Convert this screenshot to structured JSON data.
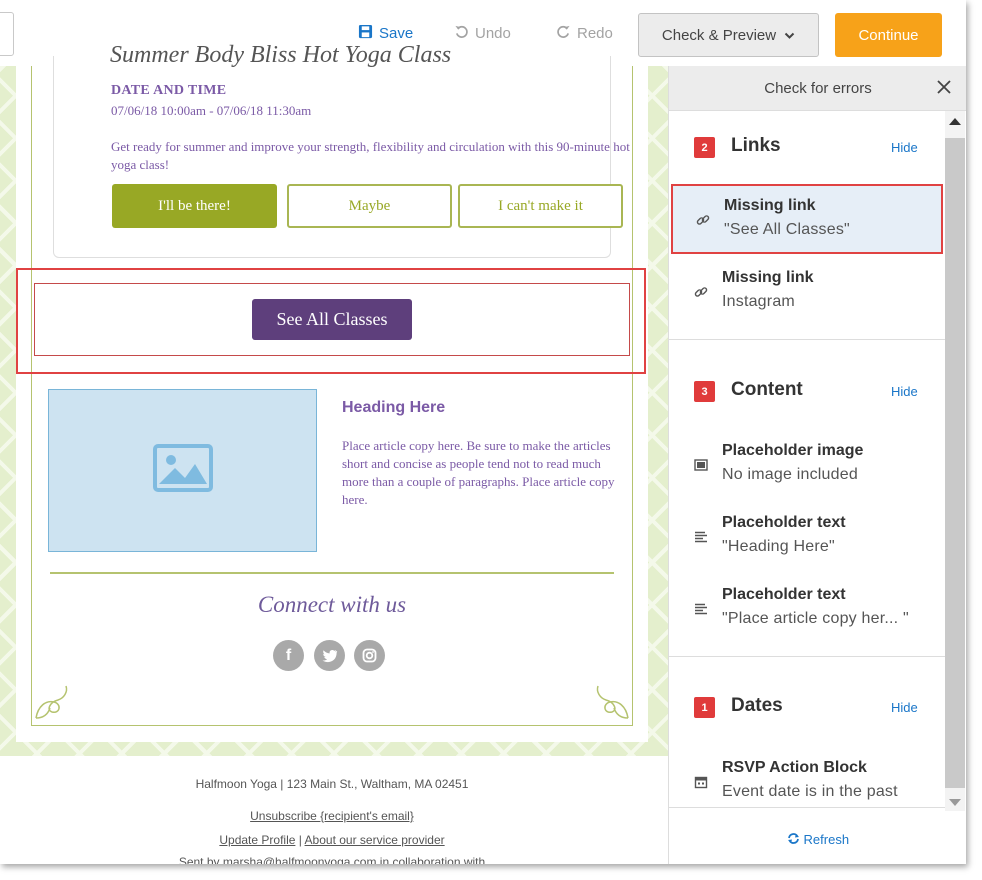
{
  "toolbar": {
    "save_label": "Save",
    "undo_label": "Undo",
    "redo_label": "Redo",
    "preview_label": "Check & Preview",
    "continue_label": "Continue"
  },
  "colors": {
    "accent_blue": "#1a76c8",
    "continue_orange": "#f7a219",
    "error_red": "#e03b3b",
    "event_purple": "#7b5aa6",
    "see_all_purple": "#5e3f7c",
    "rsvp_green": "#98a825"
  },
  "email": {
    "event_title_fragment": "Summer Body Bliss Hot Yoga Class",
    "date_time_label": "DATE AND TIME",
    "date_time_value": "07/06/18 10:00am - 07/06/18 11:30am",
    "event_description": "Get ready for summer and improve your strength, flexibility and circulation with this 90-minute hot yoga class!",
    "rsvp_yes": "I'll be there!",
    "rsvp_maybe": "Maybe",
    "rsvp_no": "I can't make it",
    "see_all_button": "See All Classes",
    "heading": "Heading Here",
    "article": "Place article copy here. Be sure to make the articles short and concise as people tend not to read much more than a couple of paragraphs. Place article copy here.",
    "connect_heading": "Connect with us",
    "social_icons": [
      "facebook-icon",
      "twitter-icon",
      "instagram-icon"
    ]
  },
  "footer": {
    "address": "Halfmoon Yoga | 123 Main St., Waltham, MA 02451",
    "unsubscribe": "Unsubscribe {recipient's email}",
    "update_profile": "Update Profile",
    "separator": "|",
    "about_provider": "About our service provider",
    "sent_by": "Sent by marsha@halfmoonyoga.com in collaboration with"
  },
  "panel": {
    "title": "Check for errors",
    "refresh_label": "Refresh",
    "sections": [
      {
        "count": "2",
        "title": "Links",
        "hide_label": "Hide",
        "items": [
          {
            "icon": "link-icon",
            "title": "Missing link",
            "detail": "\"See All Classes\"",
            "selected": true
          },
          {
            "icon": "link-icon",
            "title": "Missing link",
            "detail": "Instagram",
            "selected": false
          }
        ]
      },
      {
        "count": "3",
        "title": "Content",
        "hide_label": "Hide",
        "items": [
          {
            "icon": "image-icon",
            "title": "Placeholder image",
            "detail": "No image included",
            "selected": false
          },
          {
            "icon": "text-lines-icon",
            "title": "Placeholder text",
            "detail": "\"Heading Here\"",
            "selected": false
          },
          {
            "icon": "text-lines-icon",
            "title": "Placeholder text",
            "detail": "\"Place article copy her... \"",
            "selected": false
          }
        ]
      },
      {
        "count": "1",
        "title": "Dates",
        "hide_label": "Hide",
        "items": [
          {
            "icon": "calendar-icon",
            "title": "RSVP Action Block",
            "detail": "Event date is in the past",
            "selected": false
          }
        ]
      }
    ]
  }
}
